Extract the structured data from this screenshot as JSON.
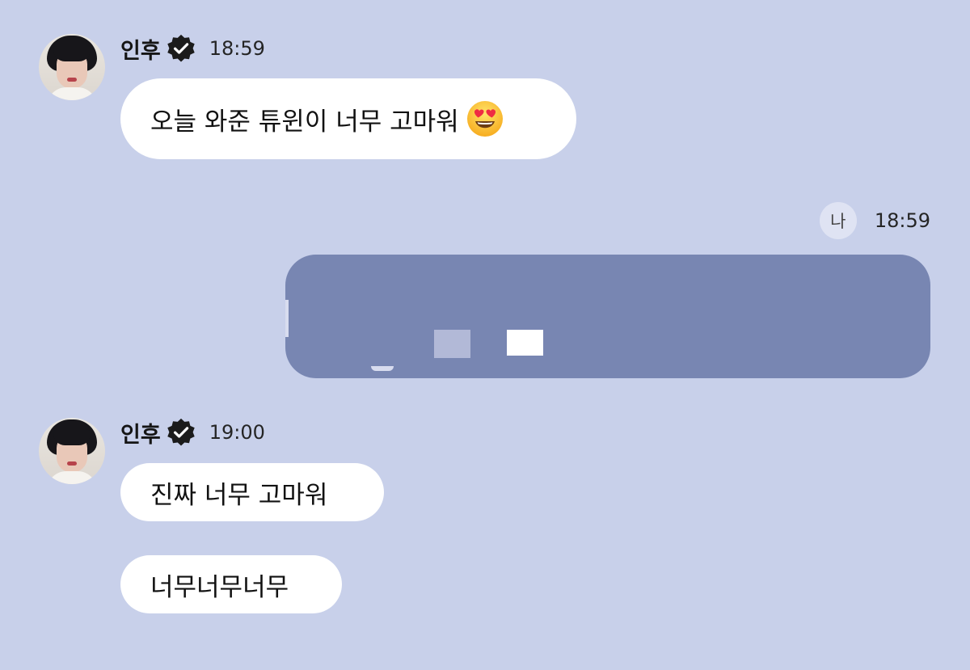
{
  "conversation": [
    {
      "sender": "인후",
      "verified": true,
      "time": "18:59",
      "messages": [
        {
          "text": "오늘 와준 튜윈이 너무 고마워",
          "emoji": "smiling-face-with-heart-eyes"
        }
      ]
    },
    {
      "self_label": "나",
      "time": "18:59",
      "message_redacted": true
    },
    {
      "sender": "인후",
      "verified": true,
      "time": "19:00",
      "messages": [
        {
          "text": "진짜 너무 고마워"
        },
        {
          "text": "너무너무너무"
        }
      ]
    }
  ],
  "icons": {
    "verified": "verified-check-icon",
    "emoji": "heart-eyes-emoji-icon"
  },
  "colors": {
    "background": "#c8d0ea",
    "bubble": "#ffffff",
    "redaction": "#7886b2",
    "self_badge": "#dfe3f3"
  }
}
